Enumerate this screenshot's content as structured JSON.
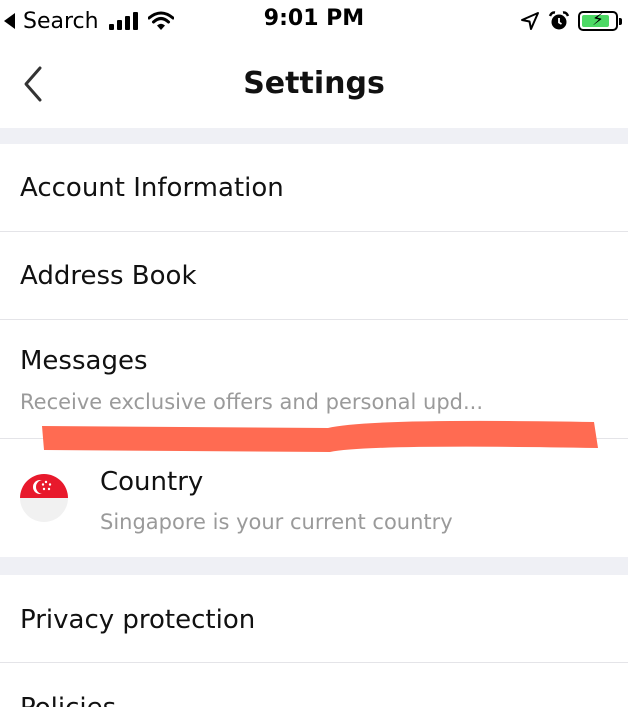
{
  "status_bar": {
    "back_app_label": "Search",
    "time": "9:01 PM",
    "battery_charge": 0.85
  },
  "nav": {
    "title": "Settings"
  },
  "settings": {
    "account_information": "Account Information",
    "address_book": "Address Book",
    "messages": {
      "label": "Messages",
      "subtitle": "Receive exclusive offers and personal upd..."
    },
    "country": {
      "label": "Country",
      "subtitle": "Singapore is your current country",
      "flag": "singapore-flag-icon"
    },
    "privacy_protection": "Privacy protection",
    "policies": "Policies"
  },
  "colors": {
    "section_gap": "#eff0f5",
    "subtitle_text": "#9a9a9a",
    "redaction_mark": "#ff6b52",
    "flag_red": "#e8192c"
  }
}
